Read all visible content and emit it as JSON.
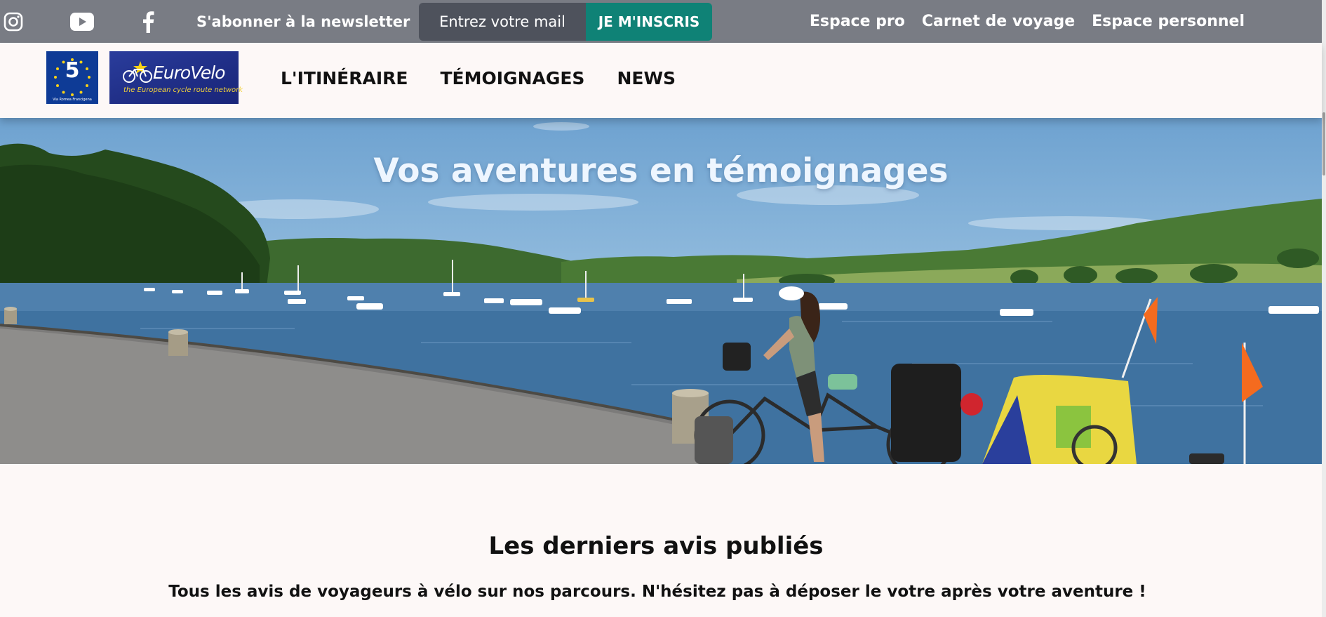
{
  "topbar": {
    "social": [
      "instagram-icon",
      "youtube-icon",
      "facebook-icon"
    ],
    "newsletter_label": "S'abonner à la newsletter",
    "mail_placeholder": "Entrez votre mail",
    "subscribe_label": "JE M'INSCRIS",
    "links": [
      "Espace pro",
      "Carnet de voyage",
      "Espace personnel"
    ]
  },
  "header": {
    "logo_v5_number": "5",
    "logo_v5_tagline": "Via Romea Francigena",
    "logo_ev_name": "EuroVelo",
    "logo_ev_tagline": "the European cycle route network",
    "nav": [
      "L'ITINÉRAIRE",
      "TÉMOIGNAGES",
      "NEWS"
    ]
  },
  "hero": {
    "title": "Vos aventures en témoignages"
  },
  "content": {
    "title": "Les derniers avis publiés",
    "subtitle": "Tous les avis de voyageurs à vélo sur nos parcours. N'hésitez pas à déposer le votre après votre aventure !"
  },
  "colors": {
    "topbar_bg": "#797c84",
    "input_bg": "#4e525c",
    "subscribe_bg": "#0f8276",
    "page_bg": "#fdf8f7"
  }
}
